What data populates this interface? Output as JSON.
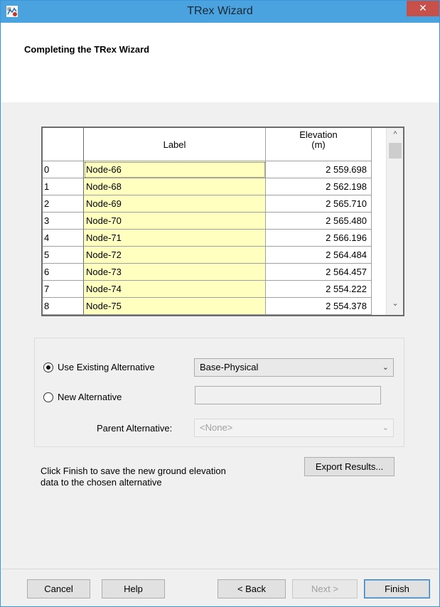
{
  "window": {
    "title": "TRex Wizard",
    "close_glyph": "✕",
    "app_icon": "trex-app-icon"
  },
  "header": {
    "title": "Completing the TRex Wizard"
  },
  "grid": {
    "columns": [
      "",
      "Label",
      "Elevation\n(m)"
    ],
    "col_label": "Label",
    "col_elev_line1": "Elevation",
    "col_elev_line2": "(m)",
    "rows": [
      {
        "idx": "0",
        "label": "Node-66",
        "elevation": "2 559.698"
      },
      {
        "idx": "1",
        "label": "Node-68",
        "elevation": "2 562.198"
      },
      {
        "idx": "2",
        "label": "Node-69",
        "elevation": "2 565.710"
      },
      {
        "idx": "3",
        "label": "Node-70",
        "elevation": "2 565.480"
      },
      {
        "idx": "4",
        "label": "Node-71",
        "elevation": "2 566.196"
      },
      {
        "idx": "5",
        "label": "Node-72",
        "elevation": "2 564.484"
      },
      {
        "idx": "6",
        "label": "Node-73",
        "elevation": "2 564.457"
      },
      {
        "idx": "7",
        "label": "Node-74",
        "elevation": "2 554.222"
      },
      {
        "idx": "8",
        "label": "Node-75",
        "elevation": "2 554.378"
      }
    ],
    "scroll_up": "^",
    "scroll_down": "⌄"
  },
  "options": {
    "use_existing_label": "Use Existing Alternative",
    "use_existing_selected": true,
    "existing_value": "Base-Physical",
    "new_alt_label": "New Alternative",
    "new_alt_selected": false,
    "new_alt_value": "",
    "parent_label": "Parent Alternative:",
    "parent_value": "<None>",
    "chevron": "⌄"
  },
  "info": {
    "line1": "Click Finish to save the new ground elevation",
    "line2": "data to the chosen alternative"
  },
  "buttons": {
    "export": "Export Results...",
    "cancel": "Cancel",
    "help": "Help",
    "back": "< Back",
    "next": "Next >",
    "finish": "Finish"
  }
}
